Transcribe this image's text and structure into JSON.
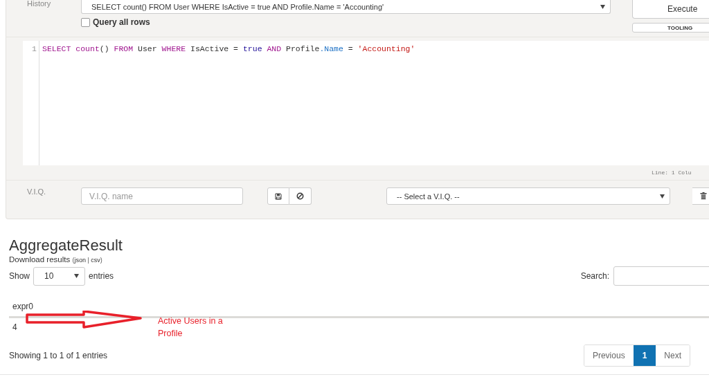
{
  "history": {
    "label": "History",
    "value": "SELECT count() FROM User WHERE IsActive = true AND Profile.Name = 'Accounting'"
  },
  "query_all_rows": {
    "label": "Query all rows",
    "checked": false
  },
  "buttons": {
    "execute": "Execute",
    "tooling": "TOOLING"
  },
  "editor": {
    "line_number": "1",
    "tokens": [
      {
        "kind": "keyword",
        "text": "SELECT "
      },
      {
        "kind": "keyword",
        "text": "count"
      },
      {
        "kind": "plain",
        "text": "() "
      },
      {
        "kind": "keyword",
        "text": "FROM"
      },
      {
        "kind": "plain",
        "text": " User "
      },
      {
        "kind": "keyword",
        "text": "WHERE"
      },
      {
        "kind": "plain",
        "text": " IsActive = "
      },
      {
        "kind": "atom",
        "text": "true "
      },
      {
        "kind": "keyword",
        "text": "AND"
      },
      {
        "kind": "plain",
        "text": " Profile"
      },
      {
        "kind": "property",
        "text": ".Name"
      },
      {
        "kind": "plain",
        "text": " = "
      },
      {
        "kind": "string",
        "text": "'Accounting'"
      }
    ],
    "status": "Line: 1 Colu"
  },
  "viq": {
    "label": "V.I.Q.",
    "placeholder": "V.I.Q. name",
    "select": "-- Select a V.I.Q. --"
  },
  "result": {
    "title": "AggregateResult",
    "download_label": "Download results",
    "download_links": [
      "json",
      "csv"
    ],
    "download_punct": [
      "(",
      "|",
      ")"
    ],
    "show_label": "Show",
    "page_size": "10",
    "entries_label": "entries",
    "search_label": "Search:",
    "columns": [
      "expr0"
    ],
    "rows": [
      [
        "4"
      ]
    ],
    "info": "Showing 1 to 1 of 1 entries",
    "pagination": [
      {
        "label": "Previous",
        "selected": false
      },
      {
        "label": "1",
        "selected": true
      },
      {
        "label": "Next",
        "selected": false
      }
    ]
  },
  "annotation": {
    "text": "Active Users in a Profile"
  }
}
